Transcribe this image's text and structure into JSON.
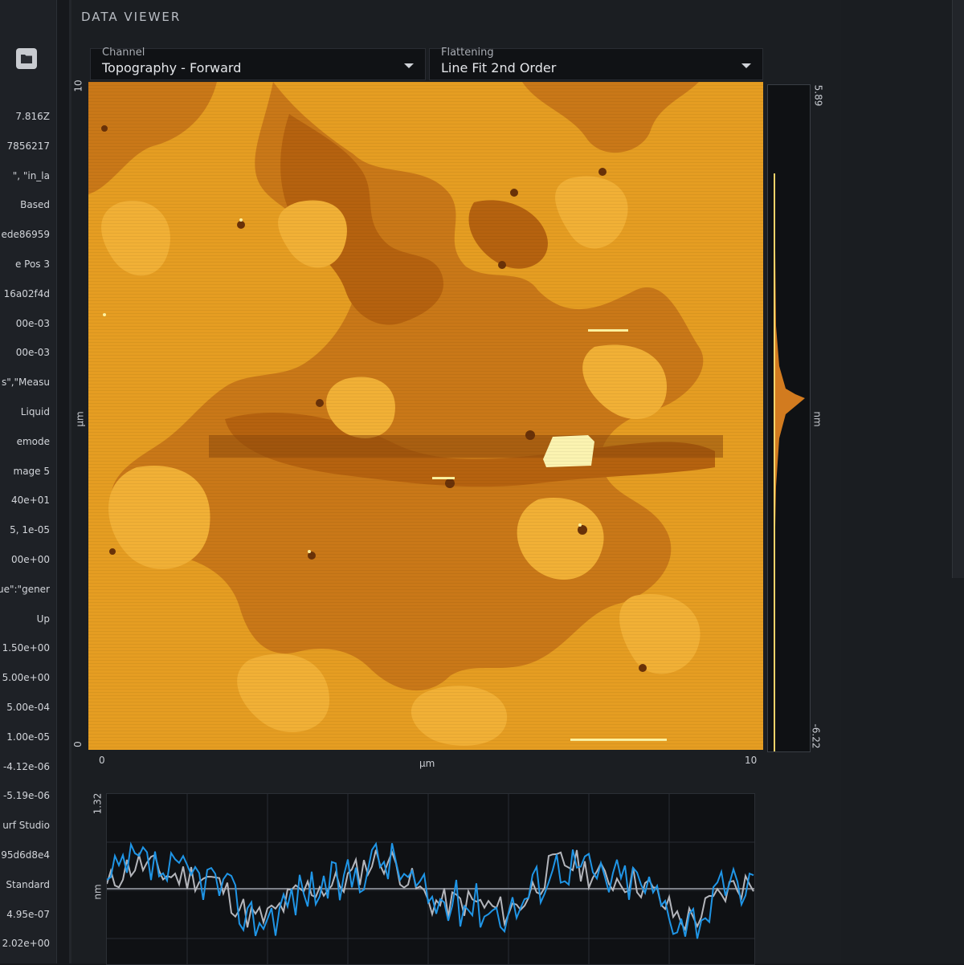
{
  "panel": {
    "title": "DATA VIEWER",
    "channel": {
      "label": "Channel",
      "value": "Topography - Forward"
    },
    "flattening": {
      "label": "Flattening",
      "value": "Line Fit 2nd Order"
    }
  },
  "image_axes": {
    "y_top": "10",
    "y_bottom": "0",
    "y_unit": "μm",
    "x_left": "0",
    "x_right": "10",
    "x_unit": "μm"
  },
  "colorbar": {
    "max": "5.89",
    "min": "-6.22",
    "unit": "nm"
  },
  "profile": {
    "y_max": "1.32",
    "y_unit": "nm"
  },
  "left_properties": [
    "7.816Z",
    "7856217",
    "\", \"in_la",
    "Based",
    "ede86959",
    "e Pos 3",
    "16a02f4d",
    "00e-03",
    "00e-03",
    "s\",\"Measu",
    "Liquid",
    "emode",
    "mage 5",
    "40e+01",
    "5, 1e-05",
    "00e+00",
    "ue\":\"gener",
    "Up",
    "1.50e+00",
    "5.00e+00",
    "5.00e-04",
    "1.00e-05",
    "-4.12e-06",
    "-5.19e-06",
    "urf Studio",
    "95d6d8e4",
    "Standard",
    "4.95e-07",
    "2.02e+00"
  ],
  "icons": {
    "open": "folder-icon",
    "dropdown": "chevron-down-icon"
  },
  "colors": {
    "afm_high": "#f8d060",
    "afm_mid": "#e9a125",
    "afm_low": "#b9650f",
    "profile_blue": "#1f95e6",
    "profile_gray": "#b4b6bc"
  }
}
